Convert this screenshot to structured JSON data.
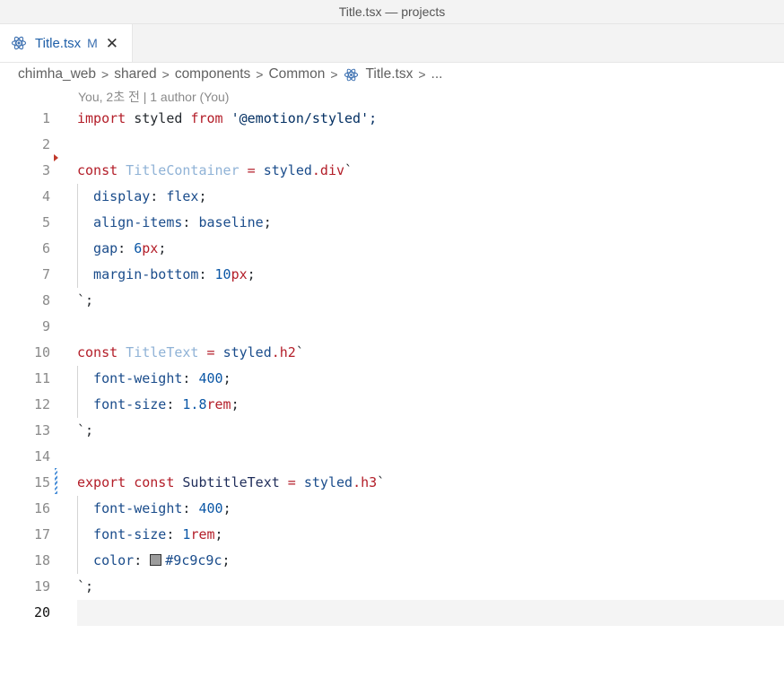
{
  "window": {
    "title": "Title.tsx — projects"
  },
  "tab": {
    "title": "Title.tsx",
    "modified": "M",
    "close": "✕"
  },
  "breadcrumb": {
    "items": [
      "chimha_web",
      "shared",
      "components",
      "Common",
      "Title.tsx",
      "..."
    ],
    "separator": ">"
  },
  "codelens": {
    "text": "You, 2초 전 | 1 author (You)"
  },
  "editor": {
    "current_line": 20,
    "lines": [
      {
        "n": "1"
      },
      {
        "n": "2"
      },
      {
        "n": "3"
      },
      {
        "n": "4"
      },
      {
        "n": "5"
      },
      {
        "n": "6"
      },
      {
        "n": "7"
      },
      {
        "n": "8"
      },
      {
        "n": "9"
      },
      {
        "n": "10"
      },
      {
        "n": "11"
      },
      {
        "n": "12"
      },
      {
        "n": "13"
      },
      {
        "n": "14"
      },
      {
        "n": "15"
      },
      {
        "n": "16"
      },
      {
        "n": "17"
      },
      {
        "n": "18"
      },
      {
        "n": "19"
      },
      {
        "n": "20"
      }
    ],
    "tokens": {
      "l1": {
        "a": "import",
        "b": " styled ",
        "c": "from",
        "d": " '@emotion/styled';"
      },
      "l3": {
        "a": "const",
        "b": " TitleContainer",
        "c": " = ",
        "d": "styled",
        "e": ".div",
        "f": "`"
      },
      "l4": {
        "a": "  display",
        "b": ": ",
        "c": "flex",
        "d": ";"
      },
      "l5": {
        "a": "  align-items",
        "b": ": ",
        "c": "baseline",
        "d": ";"
      },
      "l6": {
        "a": "  gap",
        "b": ": ",
        "c": "6",
        "d": "px",
        "e": ";"
      },
      "l7": {
        "a": "  margin-bottom",
        "b": ": ",
        "c": "10",
        "d": "px",
        "e": ";"
      },
      "l8": {
        "a": "`;"
      },
      "l10": {
        "a": "const",
        "b": " TitleText",
        "c": " = ",
        "d": "styled",
        "e": ".h2",
        "f": "`"
      },
      "l11": {
        "a": "  font-weight",
        "b": ": ",
        "c": "400",
        "d": ";"
      },
      "l12": {
        "a": "  font-size",
        "b": ": ",
        "c": "1.8",
        "d": "rem",
        "e": ";"
      },
      "l13": {
        "a": "`;"
      },
      "l15": {
        "a": "export",
        "b": " ",
        "c": "const",
        "d": " SubtitleText",
        "e": " = ",
        "f": "styled",
        "g": ".h3",
        "h": "`"
      },
      "l16": {
        "a": "  font-weight",
        "b": ": ",
        "c": "400",
        "d": ";"
      },
      "l17": {
        "a": "  font-size",
        "b": ": ",
        "c": "1",
        "d": "rem",
        "e": ";"
      },
      "l18": {
        "a": "  color",
        "b": ": ",
        "c": "#9c9c9c",
        "d": ";"
      },
      "l19": {
        "a": "`;"
      }
    }
  },
  "colors": {
    "swatch": "#9c9c9c",
    "accent": "#1f5fa8"
  },
  "icons": {
    "tab_icon": "react-icon",
    "breadcrumb_icon": "react-icon"
  }
}
